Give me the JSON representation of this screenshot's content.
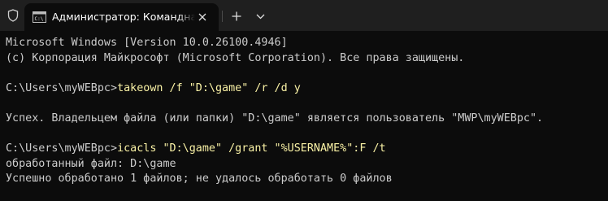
{
  "window": {
    "tab_title": "Администратор: Командная строка"
  },
  "icons": {
    "shield": "shield-icon",
    "tab": "cmd-icon",
    "close": "close-icon",
    "new_tab": "plus-icon",
    "dropdown": "chevron-down-icon"
  },
  "colors": {
    "background": "#0c0c0c",
    "tabbar": "#1f1f1f",
    "text": "#cccccc",
    "command": "#f9f1a5"
  },
  "terminal": {
    "lines": [
      {
        "prompt": "Microsoft Windows [Version 10.0.26100.4946]",
        "cmd": ""
      },
      {
        "prompt": "(c) Корпорация Майкрософт (Microsoft Corporation). Все права защищены.",
        "cmd": ""
      },
      {
        "prompt": "",
        "cmd": ""
      },
      {
        "prompt": "C:\\Users\\myWEBpc>",
        "cmd": "takeown /f \"D:\\game\" /r /d y"
      },
      {
        "prompt": "",
        "cmd": ""
      },
      {
        "prompt": "Успех. Владельцем файла (или папки) \"D:\\game\" является пользователь \"MWP\\myWEBpc\".",
        "cmd": ""
      },
      {
        "prompt": "",
        "cmd": ""
      },
      {
        "prompt": "C:\\Users\\myWEBpc>",
        "cmd": "icacls \"D:\\game\" /grant \"%USERNAME%\":F /t"
      },
      {
        "prompt": "обработанный файл: D:\\game",
        "cmd": ""
      },
      {
        "prompt": "Успешно обработано 1 файлов; не удалось обработать 0 файлов",
        "cmd": ""
      }
    ]
  }
}
